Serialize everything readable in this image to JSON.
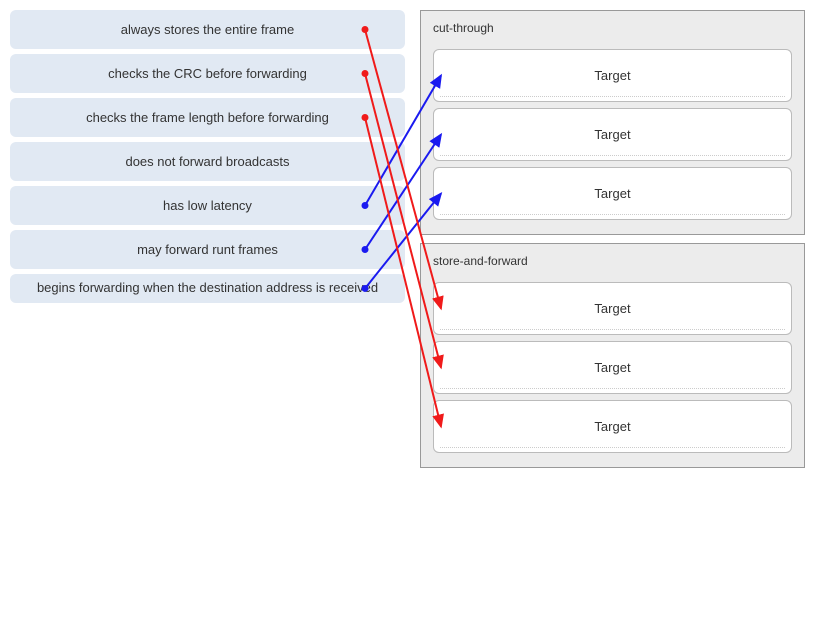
{
  "sources": [
    {
      "label": "always stores the entire frame",
      "color": "red"
    },
    {
      "label": "checks the CRC before forwarding",
      "color": "red"
    },
    {
      "label": "checks the frame length before forwarding",
      "color": "red"
    },
    {
      "label": "does not forward broadcasts",
      "color": null
    },
    {
      "label": "has low latency",
      "color": "blue"
    },
    {
      "label": "may forward runt frames",
      "color": "blue"
    },
    {
      "label": "begins forwarding when the destination address is received",
      "color": "blue",
      "multiline": true
    }
  ],
  "groups": [
    {
      "title": "cut-through",
      "targets": [
        {
          "label": "Target"
        },
        {
          "label": "Target"
        },
        {
          "label": "Target"
        }
      ]
    },
    {
      "title": "store-and-forward",
      "targets": [
        {
          "label": "Target"
        },
        {
          "label": "Target"
        },
        {
          "label": "Target"
        }
      ]
    }
  ],
  "connections": [
    {
      "from": 4,
      "to_group": 0,
      "to_slot": 0,
      "color": "blue"
    },
    {
      "from": 5,
      "to_group": 0,
      "to_slot": 1,
      "color": "blue"
    },
    {
      "from": 6,
      "to_group": 0,
      "to_slot": 2,
      "color": "blue"
    },
    {
      "from": 0,
      "to_group": 1,
      "to_slot": 0,
      "color": "red"
    },
    {
      "from": 1,
      "to_group": 1,
      "to_slot": 1,
      "color": "red"
    },
    {
      "from": 2,
      "to_group": 1,
      "to_slot": 2,
      "color": "red"
    }
  ],
  "colors": {
    "blue": "#1a1af0",
    "red": "#f01a1a"
  }
}
